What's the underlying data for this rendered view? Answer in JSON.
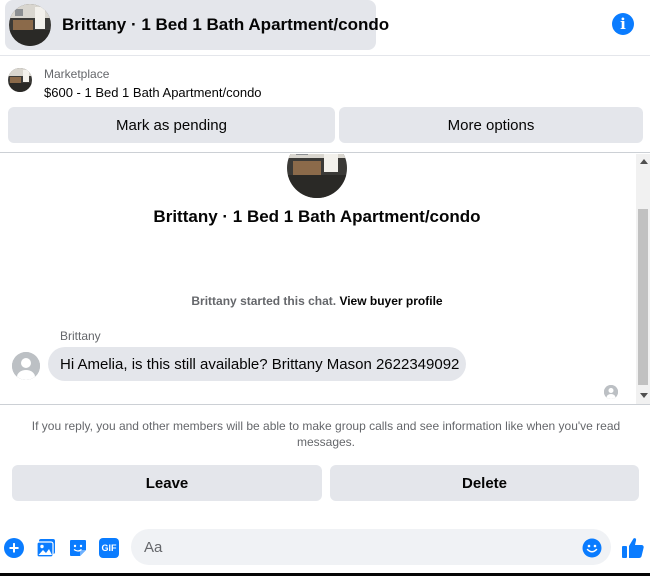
{
  "header": {
    "title": "Brittany · 1 Bed 1 Bath Apartment/condo",
    "info_icon": "info-icon"
  },
  "listing": {
    "source": "Marketplace",
    "title": "$600 - 1 Bed 1 Bath Apartment/condo",
    "actions": {
      "pending_label": "Mark as pending",
      "more_label": "More options"
    }
  },
  "thread": {
    "title": "Brittany · 1 Bed 1 Bath Apartment/condo",
    "started_text": "Brittany started this chat.",
    "profile_link": "View buyer profile",
    "messages": [
      {
        "sender": "Brittany",
        "text": "Hi Amelia, is this still available? Brittany Mason 2622349092"
      }
    ]
  },
  "notice": {
    "text": "If you reply, you and other members will be able to make group calls and see information like when you've read messages.",
    "leave_label": "Leave",
    "delete_label": "Delete"
  },
  "composer": {
    "placeholder": "Aa",
    "gif_label": "GIF",
    "icons": [
      "plus-icon",
      "photo-icon",
      "sticker-icon",
      "gif-icon",
      "emoji-icon",
      "like-icon"
    ]
  },
  "colors": {
    "accent": "#0a7cff",
    "button_bg": "#e4e6eb",
    "secondary_text": "#65676b"
  }
}
